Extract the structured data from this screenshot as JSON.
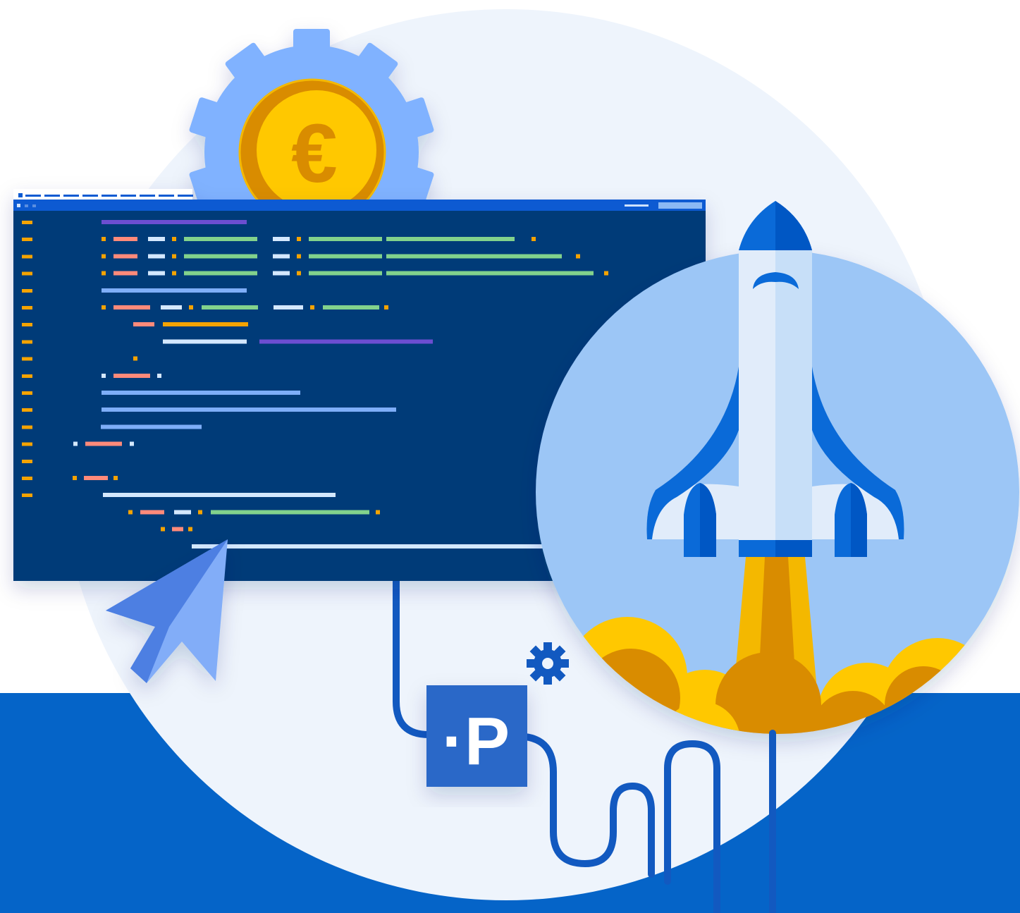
{
  "coin": {
    "symbol": "€"
  },
  "badge": {
    "label": "·P"
  },
  "icons": {
    "gear": "gear-icon",
    "coin": "euro-coin-icon",
    "rocket": "rocket-icon",
    "cursor": "mouse-cursor-icon",
    "small_gear": "small-gear-icon"
  },
  "colors": {
    "background_circle": "#eef4fc",
    "bottom_band": "#0564c8",
    "editor_bg": "#003a78",
    "editor_titlebar": "#0a5ad2",
    "gear": "#80b2ff",
    "coin_outer": "#d98c00",
    "coin_inner": "#ffc800",
    "rocket_circle": "#9cc6f6",
    "badge": "#2b68c8",
    "cable": "#1259c0"
  },
  "code_colors": {
    "o": "#f5a300",
    "s": "#ff8a7a",
    "w": "#d4e8ff",
    "g": "#82d28c",
    "b": "#7eaef8",
    "p": "#6c4ed1"
  }
}
